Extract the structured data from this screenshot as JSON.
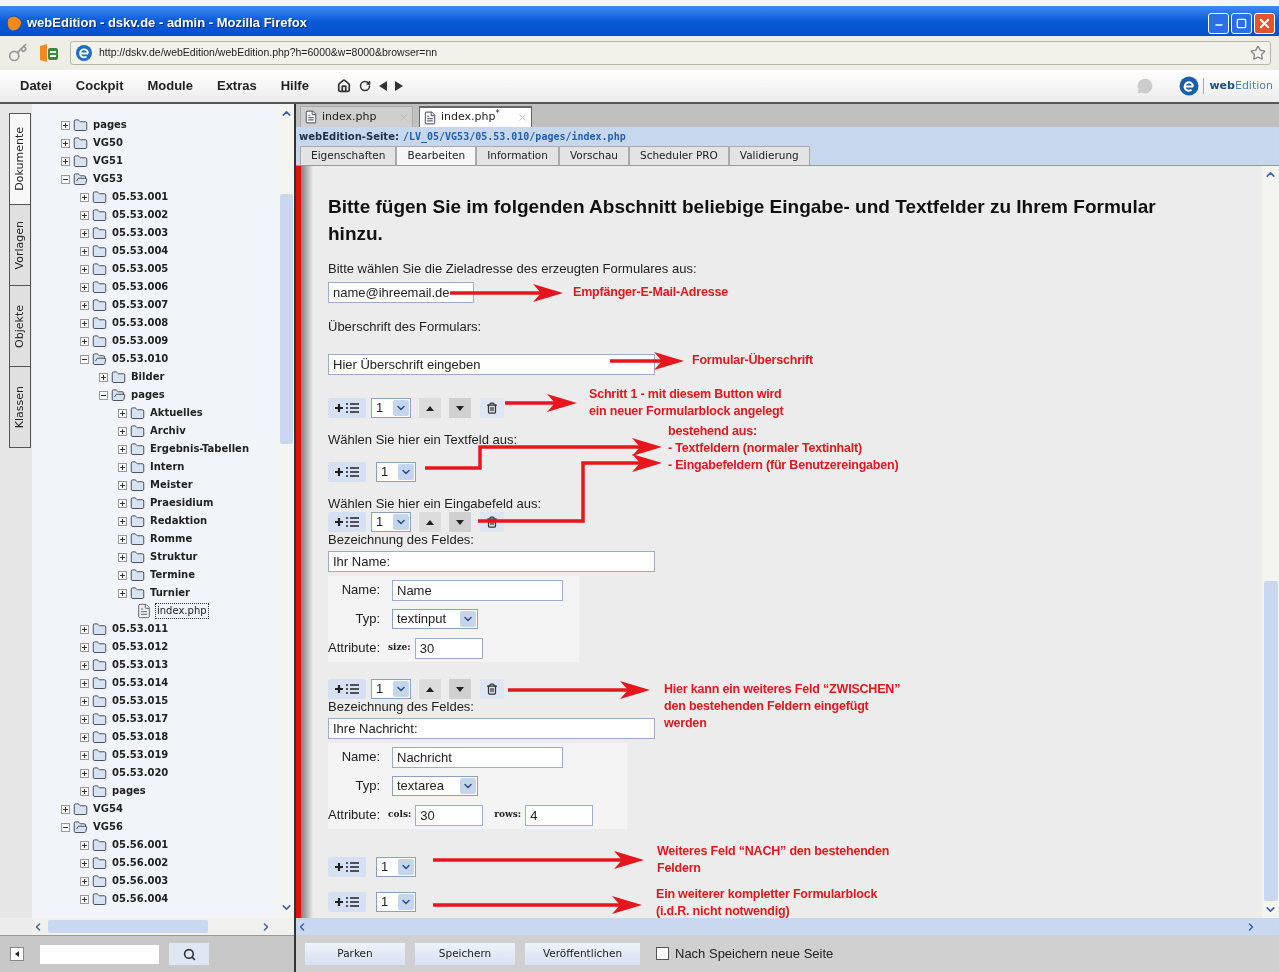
{
  "window": {
    "title": "webEdition - dskv.de - admin - Mozilla Firefox"
  },
  "browser": {
    "url": "http://dskv.de/webEdition/webEdition.php?h=6000&w=8000&browser=nn"
  },
  "menu": [
    "Datei",
    "Cockpit",
    "Module",
    "Extras",
    "Hilfe"
  ],
  "brand": "**web**Edition",
  "side_tabs": [
    {
      "label": "Dokumente",
      "selected": true
    },
    {
      "label": "Vorlagen",
      "selected": false
    },
    {
      "label": "Objekte",
      "selected": false
    },
    {
      "label": "Klassen",
      "selected": false
    }
  ],
  "tree": [
    {
      "label": "pages",
      "kind": "folder",
      "expanded": false,
      "selected": false
    },
    {
      "label": "VG50",
      "kind": "folder",
      "expanded": false,
      "selected": false
    },
    {
      "label": "VG51",
      "kind": "folder",
      "expanded": false,
      "selected": false
    },
    {
      "label": "VG53",
      "kind": "folder",
      "expanded": true,
      "selected": false,
      "children": [
        {
          "label": "05.53.001",
          "kind": "folder",
          "expanded": false,
          "selected": false
        },
        {
          "label": "05.53.002",
          "kind": "folder",
          "expanded": false,
          "selected": false
        },
        {
          "label": "05.53.003",
          "kind": "folder",
          "expanded": false,
          "selected": false
        },
        {
          "label": "05.53.004",
          "kind": "folder",
          "expanded": false,
          "selected": false
        },
        {
          "label": "05.53.005",
          "kind": "folder",
          "expanded": false,
          "selected": false
        },
        {
          "label": "05.53.006",
          "kind": "folder",
          "expanded": false,
          "selected": false
        },
        {
          "label": "05.53.007",
          "kind": "folder",
          "expanded": false,
          "selected": false
        },
        {
          "label": "05.53.008",
          "kind": "folder",
          "expanded": false,
          "selected": false
        },
        {
          "label": "05.53.009",
          "kind": "folder",
          "expanded": false,
          "selected": false
        },
        {
          "label": "05.53.010",
          "kind": "folder",
          "expanded": true,
          "selected": false,
          "children": [
            {
              "label": "Bilder",
              "kind": "folder",
              "expanded": false,
              "selected": false
            },
            {
              "label": "pages",
              "kind": "folder",
              "expanded": true,
              "selected": false,
              "children": [
                {
                  "label": "Aktuelles",
                  "kind": "folder",
                  "expanded": false,
                  "selected": false
                },
                {
                  "label": "Archiv",
                  "kind": "folder",
                  "expanded": false,
                  "selected": false
                },
                {
                  "label": "Ergebnis-Tabellen",
                  "kind": "folder",
                  "expanded": false,
                  "selected": false
                },
                {
                  "label": "Intern",
                  "kind": "folder",
                  "expanded": false,
                  "selected": false
                },
                {
                  "label": "Meister",
                  "kind": "folder",
                  "expanded": false,
                  "selected": false
                },
                {
                  "label": "Praesidium",
                  "kind": "folder",
                  "expanded": false,
                  "selected": false
                },
                {
                  "label": "Redaktion",
                  "kind": "folder",
                  "expanded": false,
                  "selected": false
                },
                {
                  "label": "Romme",
                  "kind": "folder",
                  "expanded": false,
                  "selected": false
                },
                {
                  "label": "Struktur",
                  "kind": "folder",
                  "expanded": false,
                  "selected": false
                },
                {
                  "label": "Termine",
                  "kind": "folder",
                  "expanded": false,
                  "selected": false
                },
                {
                  "label": "Turnier",
                  "kind": "folder",
                  "expanded": false,
                  "selected": false
                },
                {
                  "label": "index.php",
                  "kind": "file",
                  "selected": true
                }
              ]
            }
          ]
        },
        {
          "label": "05.53.011",
          "kind": "folder",
          "expanded": false,
          "selected": false
        },
        {
          "label": "05.53.012",
          "kind": "folder",
          "expanded": false,
          "selected": false
        },
        {
          "label": "05.53.013",
          "kind": "folder",
          "expanded": false,
          "selected": false
        },
        {
          "label": "05.53.014",
          "kind": "folder",
          "expanded": false,
          "selected": false
        },
        {
          "label": "05.53.015",
          "kind": "folder",
          "expanded": false,
          "selected": false
        },
        {
          "label": "05.53.017",
          "kind": "folder",
          "expanded": false,
          "selected": false
        },
        {
          "label": "05.53.018",
          "kind": "folder",
          "expanded": false,
          "selected": false
        },
        {
          "label": "05.53.019",
          "kind": "folder",
          "expanded": false,
          "selected": false
        },
        {
          "label": "05.53.020",
          "kind": "folder",
          "expanded": false,
          "selected": false
        },
        {
          "label": "pages",
          "kind": "folder",
          "expanded": false,
          "selected": false
        }
      ]
    },
    {
      "label": "VG54",
      "kind": "folder",
      "expanded": false,
      "selected": false
    },
    {
      "label": "VG56",
      "kind": "folder",
      "expanded": true,
      "selected": false,
      "children": [
        {
          "label": "05.56.001",
          "kind": "folder",
          "expanded": false,
          "selected": false
        },
        {
          "label": "05.56.002",
          "kind": "folder",
          "expanded": false,
          "selected": false
        },
        {
          "label": "05.56.003",
          "kind": "folder",
          "expanded": false,
          "selected": false
        },
        {
          "label": "05.56.004",
          "kind": "folder",
          "expanded": false,
          "selected": false
        }
      ]
    }
  ],
  "doc_tabs": [
    {
      "label": "index.php",
      "selected": false
    },
    {
      "label": "index.php$^{*}$",
      "selected": true
    }
  ],
  "path": {
    "label": "webEdition-Seite:",
    "value": "/LV_05/VG53/05.53.010/pages/index.php"
  },
  "edit_tabs": [
    {
      "label": "Eigenschaften",
      "selected": false
    },
    {
      "label": "Bearbeiten",
      "selected": true
    },
    {
      "label": "Information",
      "selected": false
    },
    {
      "label": "Vorschau",
      "selected": false
    },
    {
      "label": "Scheduler PRO",
      "selected": false
    },
    {
      "label": "Validierung",
      "selected": false
    }
  ],
  "form": {
    "heading": "Bitte fügen Sie im folgenden Abschnitt beliebige Eingabe- und Textfelder zu Ihrem Formular hinzu.",
    "recipient": {
      "label": "Bitte wählen Sie die Zieladresse des erzeugten Formulares aus:",
      "value": "name@ihreemail.de"
    },
    "title": {
      "label": "Überschrift des Formulars:",
      "value": "Hier Überschrift eingeben"
    },
    "block_count": "1",
    "text_field": {
      "label": "Wählen Sie hier ein Textfeld aus:",
      "count": "1"
    },
    "input_field": {
      "label": "Wählen Sie hier ein Eingabefeld aus:"
    },
    "fields": [
      {
        "count": "1",
        "caption": "Bezeichnung des Feldes:",
        "value": "Ihr Name:",
        "rows": [
          {
            "kind": "text",
            "label": "Name:",
            "value": "Name"
          },
          {
            "kind": "select",
            "label": "Typ:",
            "value": "textinput"
          },
          {
            "kind": "attributes",
            "label": "Attribute:",
            "attributes": [
              {
                "key": "size:",
                "value": "30"
              }
            ]
          }
        ]
      },
      {
        "count": "1",
        "caption": "Bezeichnung des Feldes:",
        "value": "Ihre Nachricht:",
        "rows": [
          {
            "kind": "text",
            "label": "Name:",
            "value": "Nachricht"
          },
          {
            "kind": "select",
            "label": "Typ:",
            "value": "textarea"
          },
          {
            "kind": "attributes",
            "label": "Attribute:",
            "attributes": [
              {
                "key": "cols:",
                "value": "30"
              },
              {
                "key": "rows:",
                "value": "4"
              }
            ]
          }
        ]
      }
    ],
    "append_count": "1",
    "new_block_count": "1"
  },
  "annotations": [
    "Empfänger-E-Mail-Adresse",
    "Formular-Überschrift",
    "Schritt 1 - mit diesem Button wird\nein neuer Formularblock angelegt",
    "bestehend aus:\n- Textfeldern (normaler Textinhalt)\n- Eingabefeldern (für Benutzereingaben)",
    "Hier kann ein weiteres Feld “ZWISCHEN”\nden bestehenden Feldern eingefügt\nwerden",
    "Weiteres Feld “NACH” den bestehenden\nFeldern",
    "Ein weiterer kompletter Formularblock\n(i.d.R. nicht notwendig)"
  ],
  "actions": [
    "Parken",
    "Speichern",
    "Veröffentlichen"
  ],
  "new_page": {
    "label": "Nach Speichern neue Seite",
    "checked": false
  }
}
